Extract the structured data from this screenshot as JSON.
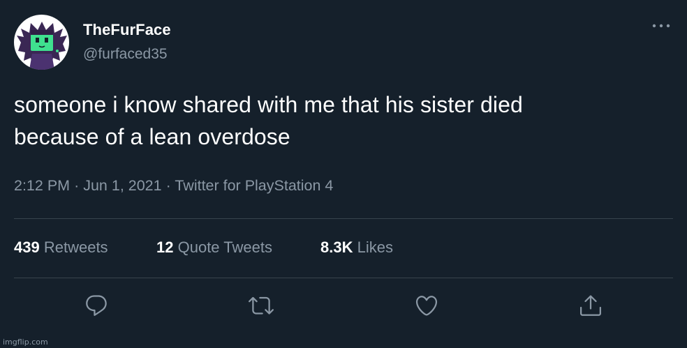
{
  "user": {
    "display_name": "TheFurFace",
    "handle": "@furfaced35"
  },
  "tweet": {
    "text_line1": "someone i know shared with me that his sister died",
    "text_line2": "because of a lean overdose",
    "time": "2:12 PM",
    "date": "Jun 1, 2021",
    "source": "Twitter for PlayStation 4",
    "separator": "·"
  },
  "stats": {
    "retweets_count": "439",
    "retweets_label": "Retweets",
    "quotes_count": "12",
    "quotes_label": "Quote Tweets",
    "likes_count": "8.3K",
    "likes_label": "Likes"
  },
  "actions": {
    "icons": [
      "reply-icon",
      "retweet-icon",
      "like-icon",
      "share-icon"
    ]
  },
  "watermark": "imgflip.com",
  "colors": {
    "background": "#15202b",
    "primary_text": "#ffffff",
    "secondary_text": "#8b98a5",
    "divider": "#38444d",
    "avatar_bg": "#ffffff",
    "avatar_figure": "#3a2754",
    "avatar_face": "#3fe08f"
  }
}
